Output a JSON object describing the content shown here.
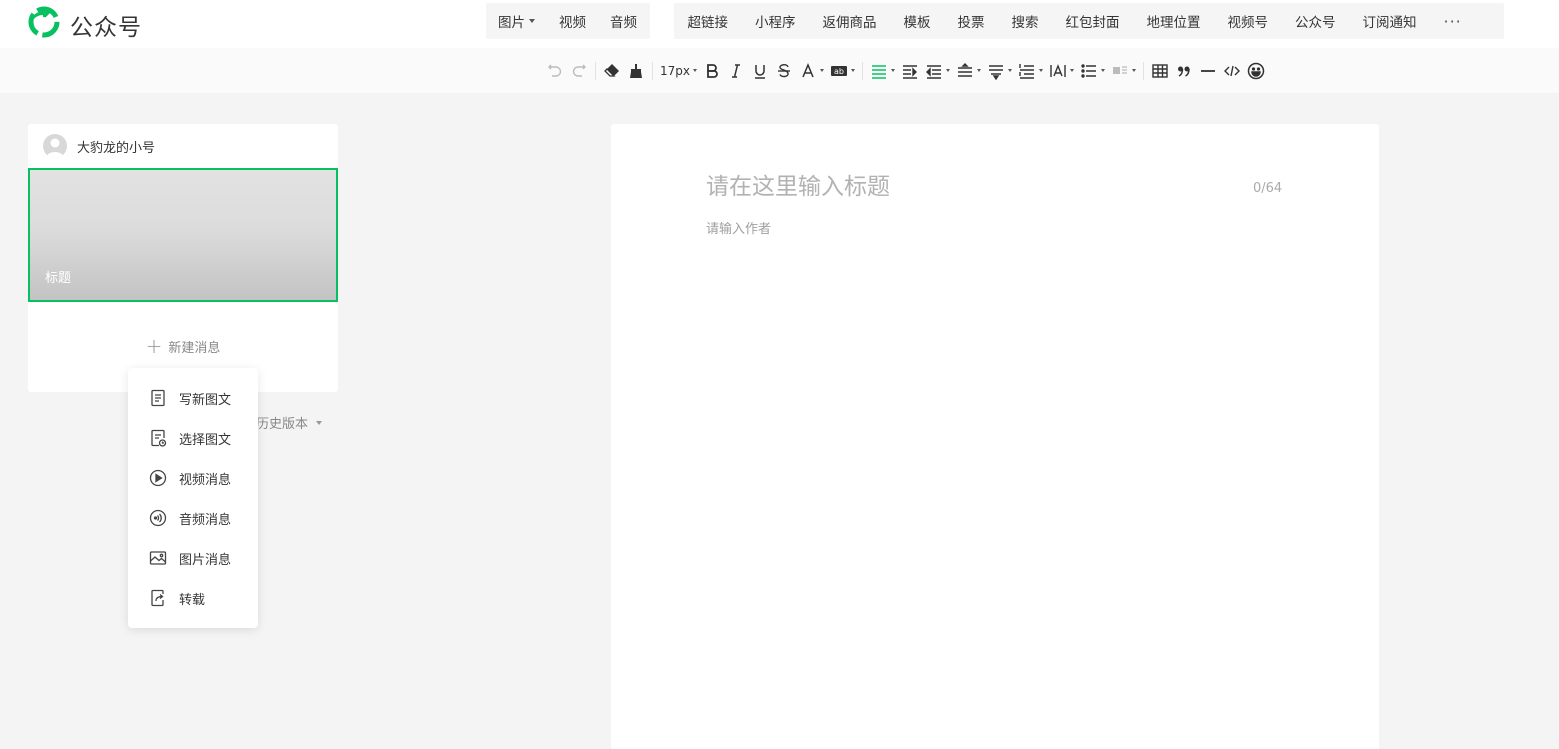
{
  "app": {
    "brand_name": "公众号",
    "brand_color": "#07c160"
  },
  "insert_bar": {
    "group1": [
      {
        "label": "图片",
        "has_dropdown": true
      },
      {
        "label": "视频"
      },
      {
        "label": "音频"
      }
    ],
    "group2": [
      {
        "label": "超链接"
      },
      {
        "label": "小程序"
      },
      {
        "label": "返佣商品"
      },
      {
        "label": "模板"
      },
      {
        "label": "投票"
      },
      {
        "label": "搜索"
      },
      {
        "label": "红包封面"
      },
      {
        "label": "地理位置"
      },
      {
        "label": "视频号"
      },
      {
        "label": "公众号"
      },
      {
        "label": "订阅通知"
      }
    ],
    "more_label": "···"
  },
  "toolbar": {
    "font_size": "17px",
    "icons": [
      "undo-icon",
      "redo-icon",
      "format-painter-icon",
      "clear-format-icon",
      "bold-icon",
      "italic-icon",
      "underline-icon",
      "strikethrough-icon",
      "font-color-icon",
      "background-color-icon",
      "align-icon",
      "indent-icon",
      "line-height-icon",
      "paragraph-spacing-icon",
      "letter-spacing-icon",
      "list-icon",
      "table-icon",
      "quote-icon",
      "divider-icon",
      "code-icon",
      "emoji-icon"
    ]
  },
  "left_panel": {
    "account_name": "大豹龙的小号",
    "article_title": "标题",
    "new_message_label": "新建消息",
    "history_label": "历史版本"
  },
  "new_message_menu": {
    "items": [
      {
        "label": "写新图文",
        "icon": "document-icon"
      },
      {
        "label": "选择图文",
        "icon": "document-select-icon"
      },
      {
        "label": "视频消息",
        "icon": "play-icon"
      },
      {
        "label": "音频消息",
        "icon": "audio-icon"
      },
      {
        "label": "图片消息",
        "icon": "image-icon"
      },
      {
        "label": "转载",
        "icon": "repost-icon"
      }
    ]
  },
  "editor": {
    "title_placeholder": "请在这里输入标题",
    "title_count": "0/64",
    "author_placeholder": "请输入作者"
  }
}
